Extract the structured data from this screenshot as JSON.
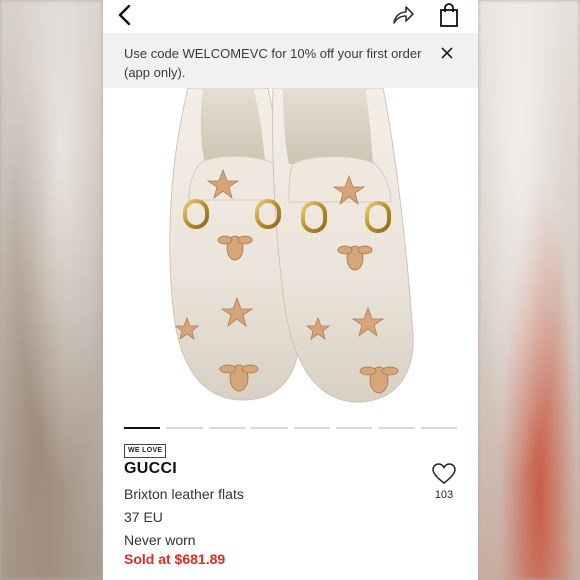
{
  "header": {
    "back_icon": "chevron-left-icon",
    "share_icon": "share-arrow-icon",
    "bag_icon": "shopping-bag-icon"
  },
  "promo": {
    "text": "Use code WELCOMEVC for 10% off your first order (app only).",
    "close_icon": "close-icon"
  },
  "gallery": {
    "image_subject": "white leather loafers with gold horsebit and embroidered stars and bees",
    "total_photos": 8,
    "active_index": 1
  },
  "product": {
    "badge": "WE LOVE",
    "brand": "GUCCI",
    "title": "Brixton leather flats",
    "size": "37 EU",
    "condition": "Never worn",
    "price": "Sold at $681.89",
    "like_count": "103"
  },
  "colors": {
    "price": "#e02b27",
    "promo_bg": "#f1f1f2",
    "active_indicator": "#111111"
  }
}
